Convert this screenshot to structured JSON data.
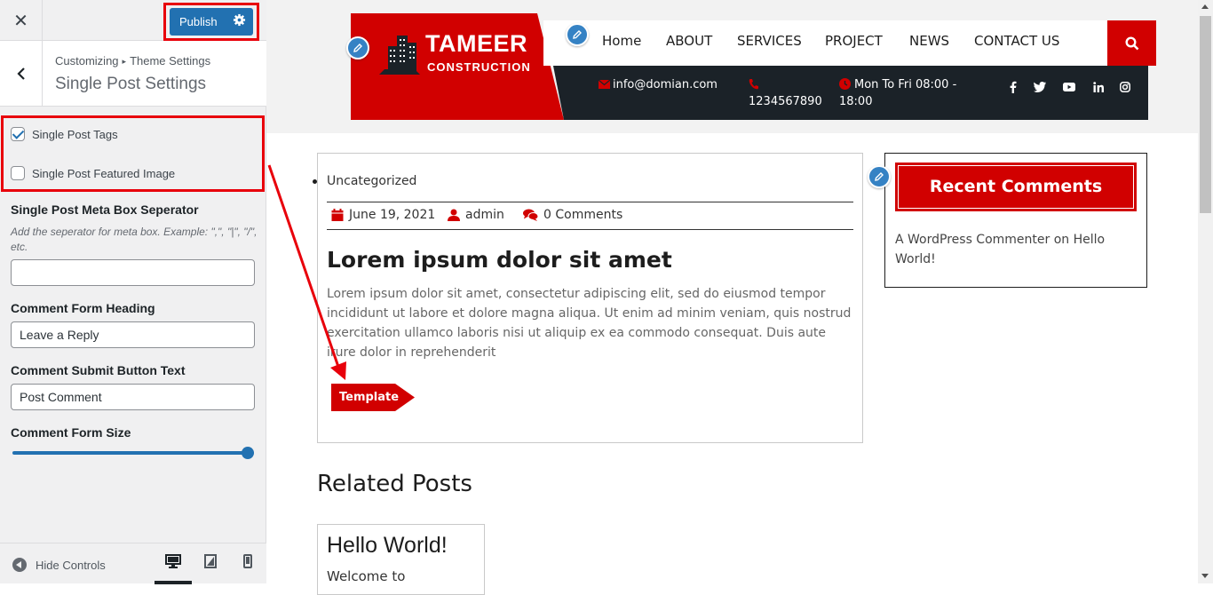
{
  "customizer": {
    "close_glyph": "✕",
    "publish_label": "Publish",
    "breadcrumb": {
      "parent": "Customizing",
      "separator": "▸",
      "current": "Theme Settings"
    },
    "section_title": "Single Post Settings",
    "checkboxes": [
      {
        "label": "Single Post Tags",
        "checked": true
      },
      {
        "label": "Single Post Featured Image",
        "checked": false
      }
    ],
    "meta_separator": {
      "label": "Single Post Meta Box Seperator",
      "description": "Add the seperator for meta box. Example: \",\", \"|\", \"/\", etc.",
      "value": ""
    },
    "comment_heading": {
      "label": "Comment Form Heading",
      "value": "Leave a Reply"
    },
    "comment_button": {
      "label": "Comment Submit Button Text",
      "value": "Post Comment"
    },
    "comment_size": {
      "label": "Comment Form Size",
      "value_fraction": 1.0
    },
    "footer": {
      "hide_controls": "Hide Controls",
      "active_device": "desktop"
    }
  },
  "site": {
    "logo": {
      "title": "TAMEER",
      "subtitle": "CONSTRUCTION"
    },
    "nav": [
      "Home",
      "ABOUT",
      "SERVICES",
      "PROJECT",
      "NEWS",
      "CONTACT US"
    ],
    "info": {
      "email": "info@domian.com",
      "phone": "1234567890",
      "hours_line1": "Mon To Fri 08:00 -",
      "hours_line2": "18:00"
    },
    "social_icons": [
      "facebook-icon",
      "twitter-icon",
      "youtube-icon",
      "linkedin-icon",
      "instagram-icon"
    ],
    "accent_color": "#d10000",
    "dark_color": "#1b2228"
  },
  "post": {
    "category": "Uncategorized",
    "date": "June 19, 2021",
    "author": "admin",
    "comments": "0 Comments",
    "title": "Lorem ipsum dolor sit amet",
    "excerpt": "Lorem ipsum dolor sit amet, consectetur adipiscing elit, sed do eiusmod tempor incididunt ut labore et dolore magna aliqua. Ut enim ad minim veniam, quis nostrud exercitation ullamco laboris nisi ut aliquip ex ea commodo consequat. Duis aute irure dolor in reprehenderit",
    "tag": "Template"
  },
  "sidebar_widget": {
    "title": "Recent Comments",
    "commenter": "A WordPress Commenter",
    "on_word": "on",
    "post_link": "Hello World!"
  },
  "related": {
    "heading": "Related Posts",
    "card_title": "Hello World!",
    "card_text": "Welcome to"
  },
  "annotation_color": "#e8000b"
}
